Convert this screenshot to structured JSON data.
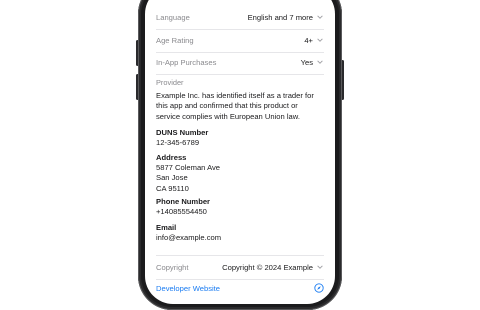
{
  "info_rows": [
    {
      "label": "Language",
      "value": "English and 7 more"
    },
    {
      "label": "Age Rating",
      "value": "4+"
    },
    {
      "label": "In-App Purchases",
      "value": "Yes"
    }
  ],
  "provider": {
    "label": "Provider",
    "text": "Example Inc. has identified itself as a trader for this app and confirmed that this product or service complies with European Union law."
  },
  "trader_details": {
    "duns": {
      "heading": "DUNS Number",
      "lines": [
        "12-345-6789"
      ]
    },
    "address": {
      "heading": "Address",
      "lines": [
        "5877 Coleman Ave",
        "San Jose",
        "CA 95110"
      ]
    },
    "phone": {
      "heading": "Phone Number",
      "lines": [
        "+14085554450"
      ]
    },
    "email": {
      "heading": "Email",
      "lines": [
        "info@example.com"
      ]
    }
  },
  "copyright": {
    "label": "Copyright",
    "value": "Copyright © 2024 Example"
  },
  "developer_website": {
    "label": "Developer Website",
    "icon": "compass-icon"
  },
  "colors": {
    "link": "#1a7cf2",
    "secondary_text": "#8a8a8e",
    "device_frame": "#1b1b1d"
  }
}
